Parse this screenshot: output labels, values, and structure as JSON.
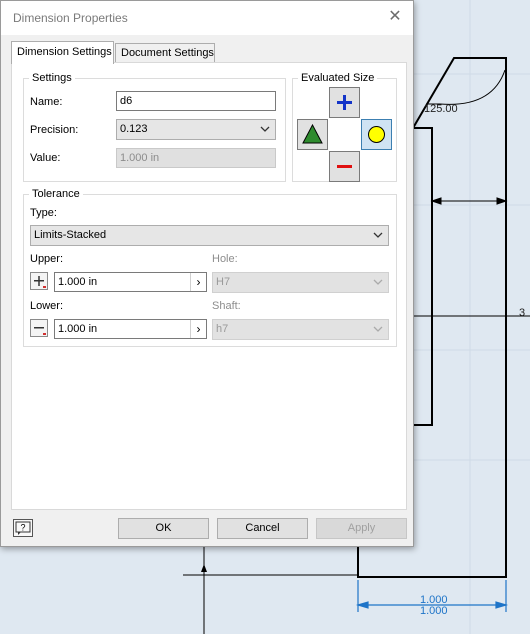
{
  "window": {
    "title": "Dimension Properties",
    "close_glyph": "✕"
  },
  "tabs": [
    {
      "label": "Dimension Settings",
      "active": true
    },
    {
      "label": "Document Settings",
      "active": false
    }
  ],
  "settings": {
    "legend": "Settings",
    "name_label": "Name:",
    "name_value": "d6",
    "precision_label": "Precision:",
    "precision_value": "0.123",
    "value_label": "Value:",
    "value_value": "1.000 in"
  },
  "evaluated": {
    "legend": "Evaluated Size",
    "icons": [
      "plus-icon",
      "triangle-icon",
      "circle-icon",
      "minus-icon"
    ],
    "colors": {
      "plus": "#1434c8",
      "triangle": "#2e8b2e",
      "circle": "#ffff00",
      "minus": "#e01010"
    }
  },
  "tolerance": {
    "legend": "Tolerance",
    "type_label": "Type:",
    "type_value": "Limits-Stacked",
    "upper_label": "Upper:",
    "upper_value": "1.000 in",
    "lower_label": "Lower:",
    "lower_value": "1.000 in",
    "hole_label": "Hole:",
    "hole_value": "H7",
    "shaft_label": "Shaft:",
    "shaft_value": "h7"
  },
  "buttons": {
    "ok": "OK",
    "cancel": "Cancel",
    "apply": "Apply",
    "help_icon": "help-icon"
  },
  "cad": {
    "angle_label": "125.00",
    "right_label": "3",
    "dim_top": "1.000",
    "dim_bottom": "1.000"
  }
}
